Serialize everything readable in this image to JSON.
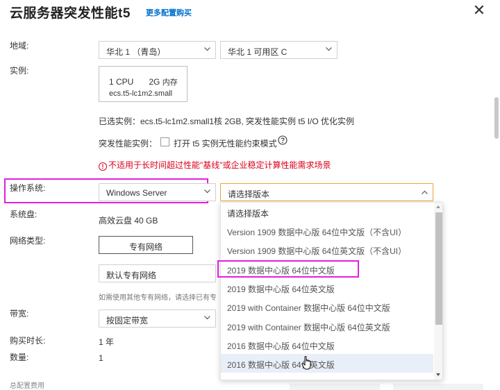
{
  "header": {
    "title": "云服务器突发性能t5",
    "more_link": "更多配置购买",
    "close_symbol": "✕"
  },
  "form": {
    "region": {
      "label": "地域:",
      "region_value": "华北 1 （青岛）",
      "zone_value": "华北 1 可用区 C"
    },
    "instance": {
      "label": "实例:",
      "cpu": "1 CPU",
      "memory": "2G",
      "memory_suffix": "内存",
      "type": "ecs.t5-lc1m2.small",
      "selected_text": "已选实例：ecs.t5-lc1m2.small1核 2GB, 突发性能实例 t5 I/O 优化实例",
      "burst_label": "突发性能实例：",
      "burst_option": "打开 t5 实例无性能约束模式",
      "warning": "不适用于长时间超过性能\"基线\"或企业稳定计算性能需求场景"
    },
    "os": {
      "label": "操作系统:",
      "os_value": "Windows Server",
      "version_placeholder": "请选择版本"
    },
    "disk": {
      "label": "系统盘:",
      "value": "高效云盘 40 GB"
    },
    "network": {
      "label": "网络类型:",
      "vpc_button": "专有网络",
      "vpc_select": "默认专有网络",
      "note": "如需使用其他专有网络，请选择已有专"
    },
    "bandwidth": {
      "label": "带宽:",
      "value": "按固定带宽"
    },
    "duration": {
      "label": "购买时长:",
      "value": "1 年"
    },
    "quantity": {
      "label": "数量:",
      "value": "1"
    },
    "total": {
      "label": "总配置费用"
    }
  },
  "dropdown": {
    "items": [
      "请选择版本",
      "Version 1909 数据中心版 64位中文版（不含UI）",
      "Version 1909 数据中心版 64位英文版（不含UI）",
      "2019 数据中心版 64位中文版",
      "2019 数据中心版 64位英文版",
      "2019 with Container 数据中心版 64位中文版",
      "2019 with Container 数据中心版 64位英文版",
      "2016 数据中心版 64位中文版",
      "2016 数据中心版 64位英文版"
    ]
  },
  "colors": {
    "highlight": "#e020e0",
    "warning": "#d9001b",
    "link": "#0070cc",
    "accent_border": "#e8a33d",
    "hover_bg": "#e9eff8"
  }
}
